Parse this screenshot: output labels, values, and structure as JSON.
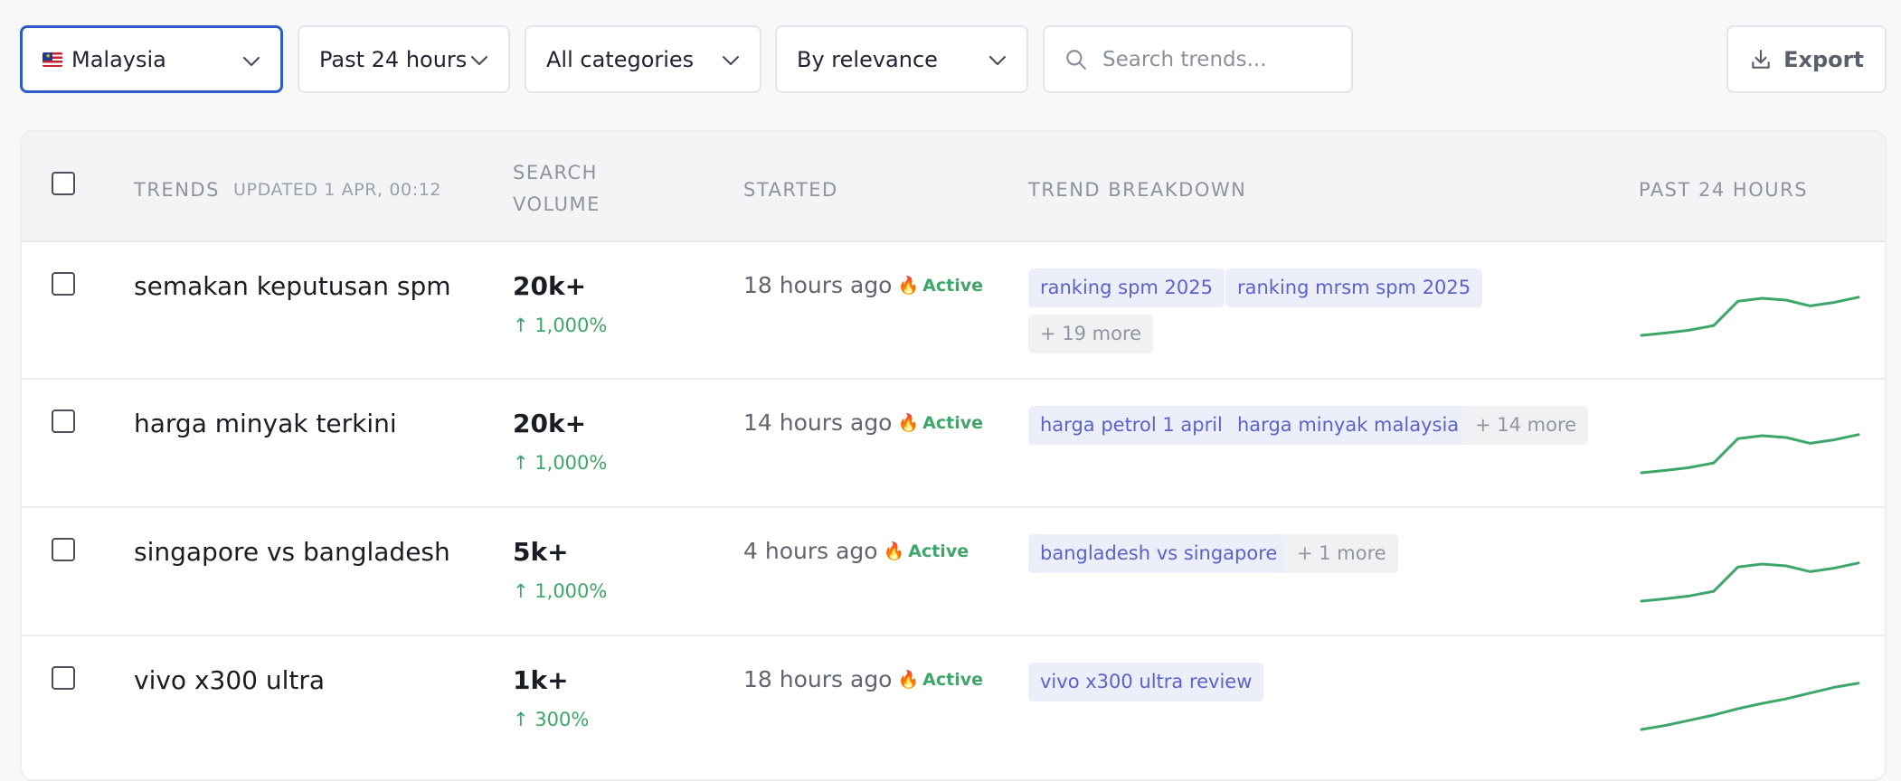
{
  "filters": {
    "region": "Malaysia",
    "time_range": "Past 24 hours",
    "category": "All categories",
    "sort": "By relevance"
  },
  "search": {
    "placeholder": "Search trends..."
  },
  "export_label": "Export",
  "table": {
    "headers": {
      "trends": "TRENDS",
      "updated": "UPDATED 1 APR, 00:12",
      "search_volume_line1": "SEARCH",
      "search_volume_line2": "VOLUME",
      "started": "STARTED",
      "breakdown": "TREND BREAKDOWN",
      "past": "PAST 24 HOURS"
    },
    "rows": [
      {
        "term": "semakan keputusan spm",
        "volume": "20k+",
        "change": "1,000%",
        "started": "18 hours ago",
        "status": "Active",
        "tags": [
          "ranking spm 2025",
          "ranking mrsm spm 2025"
        ],
        "more": "+ 19 more",
        "trend": [
          0,
          4,
          9,
          17,
          59,
          64,
          61,
          51,
          57,
          66
        ]
      },
      {
        "term": "harga minyak terkini",
        "volume": "20k+",
        "change": "1,000%",
        "started": "14 hours ago",
        "status": "Active",
        "tags": [
          "harga petrol 1 april",
          "harga minyak malaysia"
        ],
        "more": "+ 14 more",
        "trend": [
          0,
          4,
          9,
          17,
          59,
          64,
          61,
          51,
          57,
          66
        ]
      },
      {
        "term": "singapore vs bangladesh",
        "volume": "5k+",
        "change": "1,000%",
        "started": "4 hours ago",
        "status": "Active",
        "tags": [
          "bangladesh vs singapore"
        ],
        "more": "+ 1 more",
        "trend": [
          0,
          4,
          9,
          17,
          59,
          64,
          61,
          51,
          57,
          66
        ]
      },
      {
        "term": "vivo x300 ultra",
        "volume": "1k+",
        "change": "300%",
        "started": "18 hours ago",
        "status": "Active",
        "tags": [
          "vivo x300 ultra review"
        ],
        "more": "",
        "trend": [
          0,
          7,
          16,
          25,
          36,
          45,
          53,
          63,
          73,
          80
        ]
      }
    ]
  },
  "colors": {
    "accent": "#2d5cc7",
    "positive": "#3fa66b",
    "query_tag": "#5b62c9",
    "fire": "#e8641b"
  }
}
